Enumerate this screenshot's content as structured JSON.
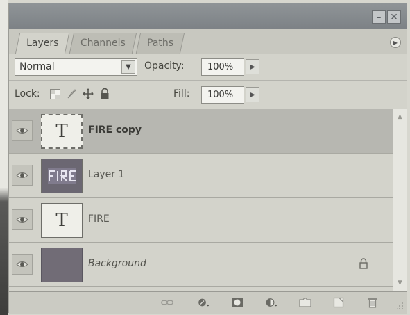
{
  "window": {
    "minimize_icon": "minimize-icon",
    "close_icon": "close-icon"
  },
  "tabs": [
    {
      "label": "Layers",
      "active": true
    },
    {
      "label": "Channels",
      "active": false
    },
    {
      "label": "Paths",
      "active": false
    }
  ],
  "options": {
    "blend_mode": "Normal",
    "opacity_label": "Opacity:",
    "opacity_value": "100%",
    "lock_label": "Lock:",
    "fill_label": "Fill:",
    "fill_value": "100%"
  },
  "layers": [
    {
      "name": "FIRE copy",
      "thumb": "T",
      "visible": true,
      "selected": true,
      "kind": "text"
    },
    {
      "name": "Layer 1",
      "thumb": "",
      "visible": true,
      "selected": false,
      "kind": "image"
    },
    {
      "name": "FIRE",
      "thumb": "T",
      "visible": true,
      "selected": false,
      "kind": "text"
    },
    {
      "name": "Background",
      "thumb": "",
      "visible": true,
      "selected": false,
      "kind": "background",
      "locked": true
    }
  ],
  "colors": {
    "panel": "#d3d3cb",
    "titlebar": "#8a8f92",
    "selected_row": "#b7b7b1",
    "background_thumb": "#716c76"
  },
  "bottom_icons": [
    "link-layers-icon",
    "layer-style-icon",
    "layer-mask-icon",
    "adjustment-layer-icon",
    "new-group-icon",
    "new-layer-icon",
    "delete-layer-icon"
  ]
}
